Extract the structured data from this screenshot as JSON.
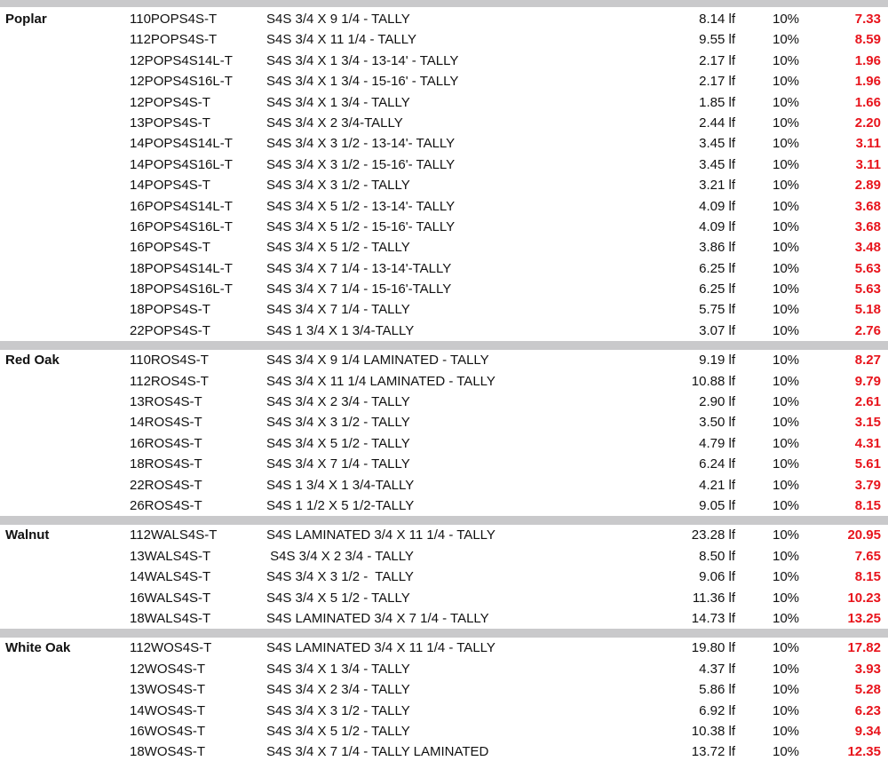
{
  "accent_color": "#e8141c",
  "sections": [
    {
      "category": "Poplar",
      "rows": [
        {
          "code": "110POPS4S-T",
          "desc": "S4S 3/4 X 9 1/4 - TALLY",
          "lf": "8.14 lf",
          "pct": "10%",
          "price": "7.33"
        },
        {
          "code": "112POPS4S-T",
          "desc": "S4S 3/4 X 11 1/4 - TALLY",
          "lf": "9.55 lf",
          "pct": "10%",
          "price": "8.59"
        },
        {
          "code": "12POPS4S14L-T",
          "desc": "S4S 3/4 X 1 3/4 - 13-14' - TALLY",
          "lf": "2.17 lf",
          "pct": "10%",
          "price": "1.96"
        },
        {
          "code": "12POPS4S16L-T",
          "desc": "S4S 3/4 X 1 3/4 - 15-16' - TALLY",
          "lf": "2.17 lf",
          "pct": "10%",
          "price": "1.96"
        },
        {
          "code": "12POPS4S-T",
          "desc": "S4S 3/4 X 1 3/4 - TALLY",
          "lf": "1.85 lf",
          "pct": "10%",
          "price": "1.66"
        },
        {
          "code": "13POPS4S-T",
          "desc": "S4S 3/4 X 2 3/4-TALLY",
          "lf": "2.44 lf",
          "pct": "10%",
          "price": "2.20"
        },
        {
          "code": "14POPS4S14L-T",
          "desc": "S4S 3/4 X 3 1/2 - 13-14'- TALLY",
          "lf": "3.45 lf",
          "pct": "10%",
          "price": "3.11"
        },
        {
          "code": "14POPS4S16L-T",
          "desc": "S4S 3/4 X 3 1/2 - 15-16'- TALLY",
          "lf": "3.45 lf",
          "pct": "10%",
          "price": "3.11"
        },
        {
          "code": "14POPS4S-T",
          "desc": "S4S 3/4 X 3 1/2 - TALLY",
          "lf": "3.21 lf",
          "pct": "10%",
          "price": "2.89"
        },
        {
          "code": "16POPS4S14L-T",
          "desc": "S4S 3/4 X 5 1/2 - 13-14'- TALLY",
          "lf": "4.09 lf",
          "pct": "10%",
          "price": "3.68"
        },
        {
          "code": "16POPS4S16L-T",
          "desc": "S4S 3/4 X 5 1/2 - 15-16'- TALLY",
          "lf": "4.09 lf",
          "pct": "10%",
          "price": "3.68"
        },
        {
          "code": "16POPS4S-T",
          "desc": "S4S 3/4 X 5 1/2 - TALLY",
          "lf": "3.86 lf",
          "pct": "10%",
          "price": "3.48"
        },
        {
          "code": "18POPS4S14L-T",
          "desc": "S4S 3/4 X 7 1/4 - 13-14'-TALLY",
          "lf": "6.25 lf",
          "pct": "10%",
          "price": "5.63"
        },
        {
          "code": "18POPS4S16L-T",
          "desc": "S4S 3/4 X 7 1/4 - 15-16'-TALLY",
          "lf": "6.25 lf",
          "pct": "10%",
          "price": "5.63"
        },
        {
          "code": "18POPS4S-T",
          "desc": "S4S 3/4 X 7 1/4 - TALLY",
          "lf": "5.75 lf",
          "pct": "10%",
          "price": "5.18"
        },
        {
          "code": "22POPS4S-T",
          "desc": "S4S 1 3/4 X 1 3/4-TALLY",
          "lf": "3.07 lf",
          "pct": "10%",
          "price": "2.76"
        }
      ]
    },
    {
      "category": "Red Oak",
      "rows": [
        {
          "code": "110ROS4S-T",
          "desc": "S4S 3/4 X 9 1/4 LAMINATED - TALLY",
          "lf": "9.19 lf",
          "pct": "10%",
          "price": "8.27"
        },
        {
          "code": "112ROS4S-T",
          "desc": "S4S 3/4 X 11 1/4 LAMINATED - TALLY",
          "lf": "10.88 lf",
          "pct": "10%",
          "price": "9.79"
        },
        {
          "code": "13ROS4S-T",
          "desc": "S4S 3/4 X 2 3/4 - TALLY",
          "lf": "2.90 lf",
          "pct": "10%",
          "price": "2.61"
        },
        {
          "code": "14ROS4S-T",
          "desc": "S4S 3/4 X 3 1/2 - TALLY",
          "lf": "3.50 lf",
          "pct": "10%",
          "price": "3.15"
        },
        {
          "code": "16ROS4S-T",
          "desc": "S4S 3/4 X 5 1/2 - TALLY",
          "lf": "4.79 lf",
          "pct": "10%",
          "price": "4.31"
        },
        {
          "code": "18ROS4S-T",
          "desc": "S4S 3/4 X 7 1/4 - TALLY",
          "lf": "6.24 lf",
          "pct": "10%",
          "price": "5.61"
        },
        {
          "code": "22ROS4S-T",
          "desc": "S4S 1 3/4 X 1 3/4-TALLY",
          "lf": "4.21 lf",
          "pct": "10%",
          "price": "3.79"
        },
        {
          "code": "26ROS4S-T",
          "desc": "S4S 1 1/2 X 5 1/2-TALLY",
          "lf": "9.05 lf",
          "pct": "10%",
          "price": "8.15"
        }
      ]
    },
    {
      "category": "Walnut",
      "rows": [
        {
          "code": "112WALS4S-T",
          "desc": "S4S LAMINATED 3/4 X 11 1/4 - TALLY",
          "lf": "23.28 lf",
          "pct": "10%",
          "price": "20.95"
        },
        {
          "code": "13WALS4S-T",
          "desc": " S4S 3/4 X 2 3/4 - TALLY",
          "lf": "8.50 lf",
          "pct": "10%",
          "price": "7.65"
        },
        {
          "code": "14WALS4S-T",
          "desc": "S4S 3/4 X 3 1/2 -  TALLY",
          "lf": "9.06 lf",
          "pct": "10%",
          "price": "8.15"
        },
        {
          "code": "16WALS4S-T",
          "desc": "S4S 3/4 X 5 1/2 - TALLY",
          "lf": "11.36 lf",
          "pct": "10%",
          "price": "10.23"
        },
        {
          "code": "18WALS4S-T",
          "desc": "S4S LAMINATED 3/4 X 7 1/4 - TALLY",
          "lf": "14.73 lf",
          "pct": "10%",
          "price": "13.25"
        }
      ]
    },
    {
      "category": "White Oak",
      "rows": [
        {
          "code": "112WOS4S-T",
          "desc": "S4S LAMINATED 3/4 X 11 1/4 - TALLY",
          "lf": "19.80 lf",
          "pct": "10%",
          "price": "17.82"
        },
        {
          "code": "12WOS4S-T",
          "desc": "S4S 3/4 X 1 3/4 - TALLY",
          "lf": "4.37 lf",
          "pct": "10%",
          "price": "3.93"
        },
        {
          "code": "13WOS4S-T",
          "desc": "S4S 3/4 X 2 3/4 - TALLY",
          "lf": "5.86 lf",
          "pct": "10%",
          "price": "5.28"
        },
        {
          "code": "14WOS4S-T",
          "desc": "S4S 3/4 X 3 1/2 - TALLY",
          "lf": "6.92 lf",
          "pct": "10%",
          "price": "6.23"
        },
        {
          "code": "16WOS4S-T",
          "desc": "S4S 3/4 X 5 1/2 - TALLY",
          "lf": "10.38 lf",
          "pct": "10%",
          "price": "9.34"
        },
        {
          "code": "18WOS4S-T",
          "desc": "S4S 3/4 X 7 1/4 - TALLY LAMINATED",
          "lf": "13.72 lf",
          "pct": "10%",
          "price": "12.35"
        }
      ]
    }
  ]
}
